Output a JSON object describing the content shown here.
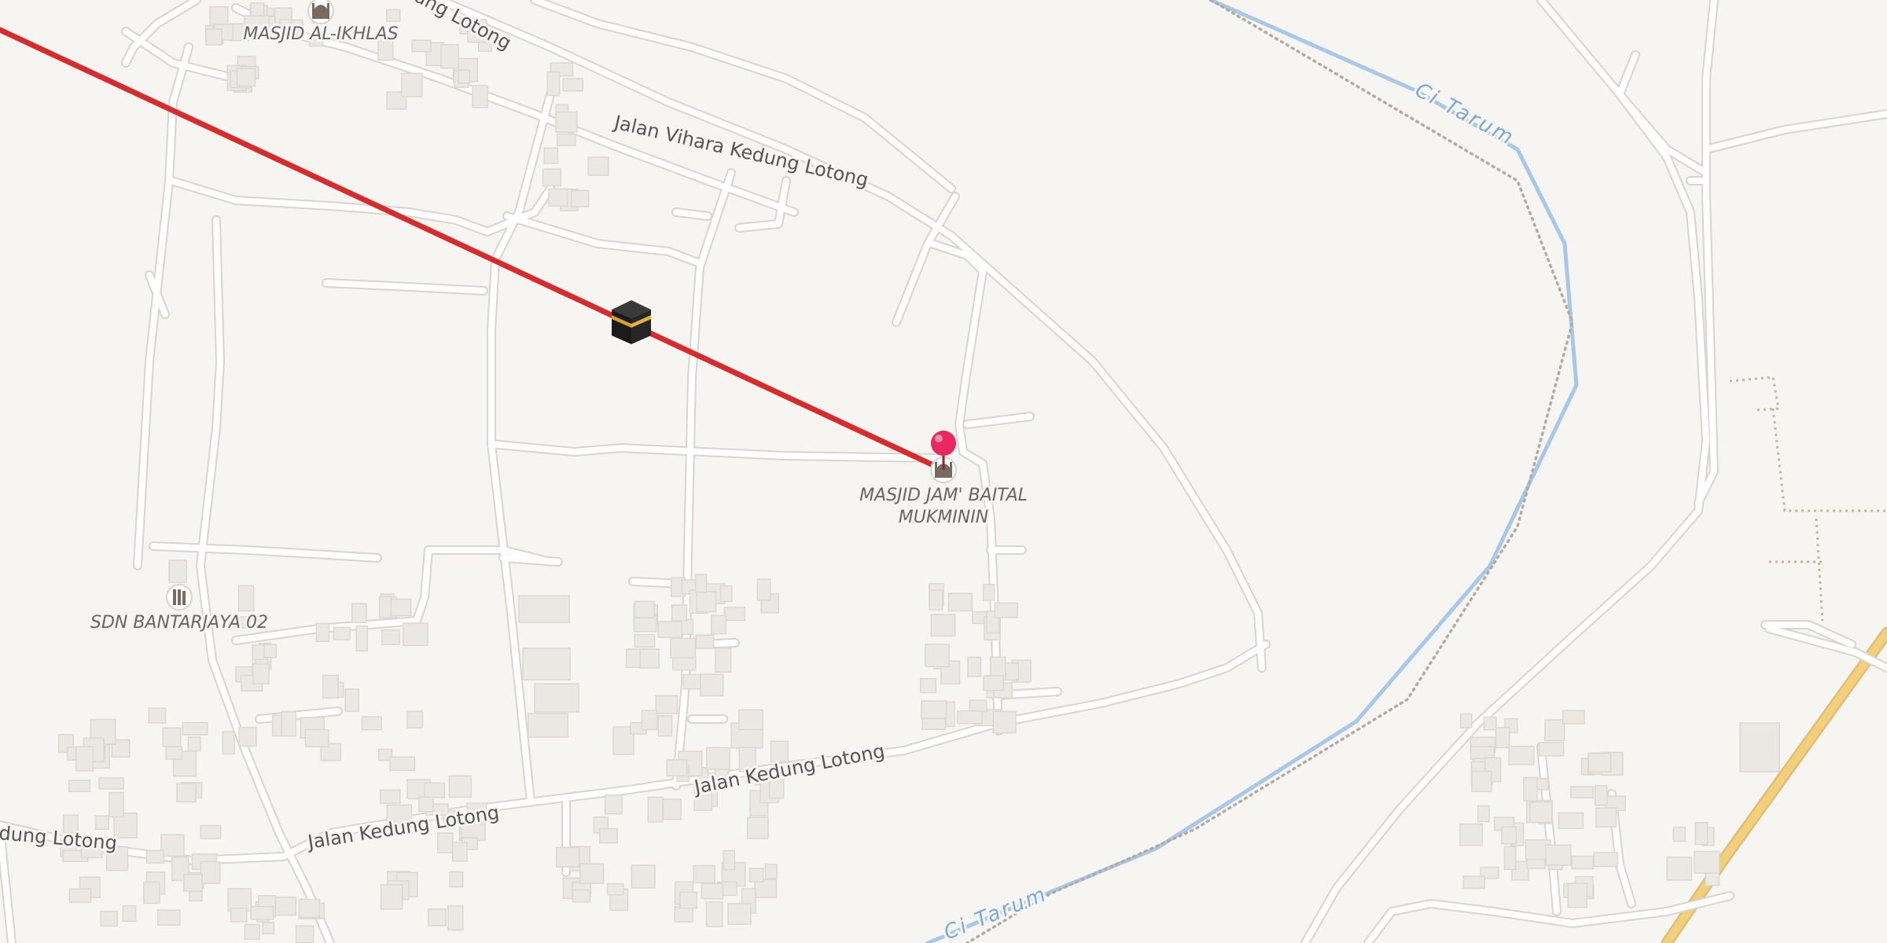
{
  "map": {
    "roads": {
      "kedung_lotong_west": "Jalan Kedung Lotong",
      "kedung_lotong_south": "Jalan Kedung Lotong",
      "kedung_lotong_mid": "Jalan Kedung Lotong",
      "kedung_lotong_north": "Jalan Kedung Lotong",
      "vihara": "Jalan Vihara Kedung Lotong"
    },
    "west_road_label_text": "dung Lotong",
    "north_road_label_text": "ung Lotong",
    "rivers": {
      "upper": "Ci Tarum",
      "lower": "Ci Tarum"
    },
    "pois": {
      "masjid_al_ikhlas": "MASJID AL-IKHLAS",
      "masjid_baital_line1": "MASJID JAM' BAITAL",
      "masjid_baital_line2": "MUKMININ",
      "school": "SDN BANTARJAYA 02"
    },
    "icons": {
      "kaaba": "kaaba-icon",
      "pin": "location-pin-icon",
      "mosque": "mosque-icon",
      "school": "school-icon"
    },
    "colors": {
      "qibla_line": "#d92b2b",
      "pin": "#e8285f",
      "river": "#a8c8ea",
      "major_road": "#f3cf7a",
      "background": "#f7f5f2"
    }
  }
}
